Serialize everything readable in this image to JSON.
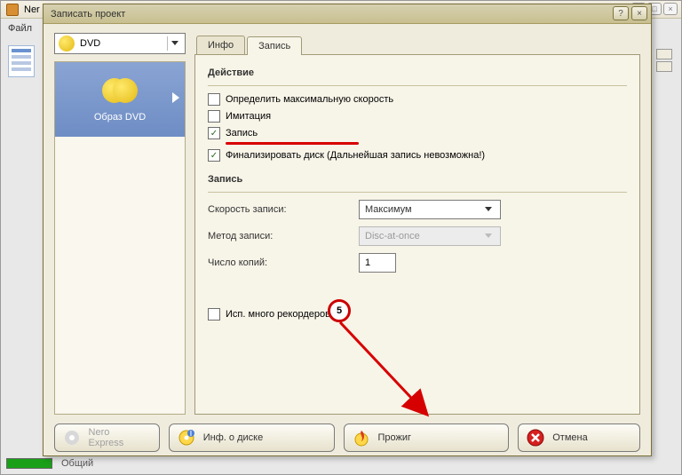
{
  "outer": {
    "app_prefix": "Ner",
    "menu_file": "Файл"
  },
  "dialog": {
    "title": "Записать проект"
  },
  "left": {
    "disc_type": "DVD",
    "thumb_label": "Образ DVD"
  },
  "tabs": {
    "info": "Инфо",
    "burn": "Запись"
  },
  "action": {
    "section": "Действие",
    "max_speed": "Определить максимальную скорость",
    "simulation": "Имитация",
    "write": "Запись",
    "finalize": "Финализировать диск (Дальнейшая запись невозможна!)"
  },
  "burn": {
    "section": "Запись",
    "speed_label": "Скорость записи:",
    "speed_value": "Максимум",
    "method_label": "Метод записи:",
    "method_value": "Disc-at-once",
    "copies_label": "Число копий:",
    "copies_value": "1",
    "multi_rec": "Исп. много рекордеров"
  },
  "buttons": {
    "nero_express": "Nero Express",
    "disc_info": "Инф. о диске",
    "burn": "Прожиг",
    "cancel": "Отмена"
  },
  "status": {
    "text": "Общий"
  },
  "callout": {
    "num": "5"
  }
}
